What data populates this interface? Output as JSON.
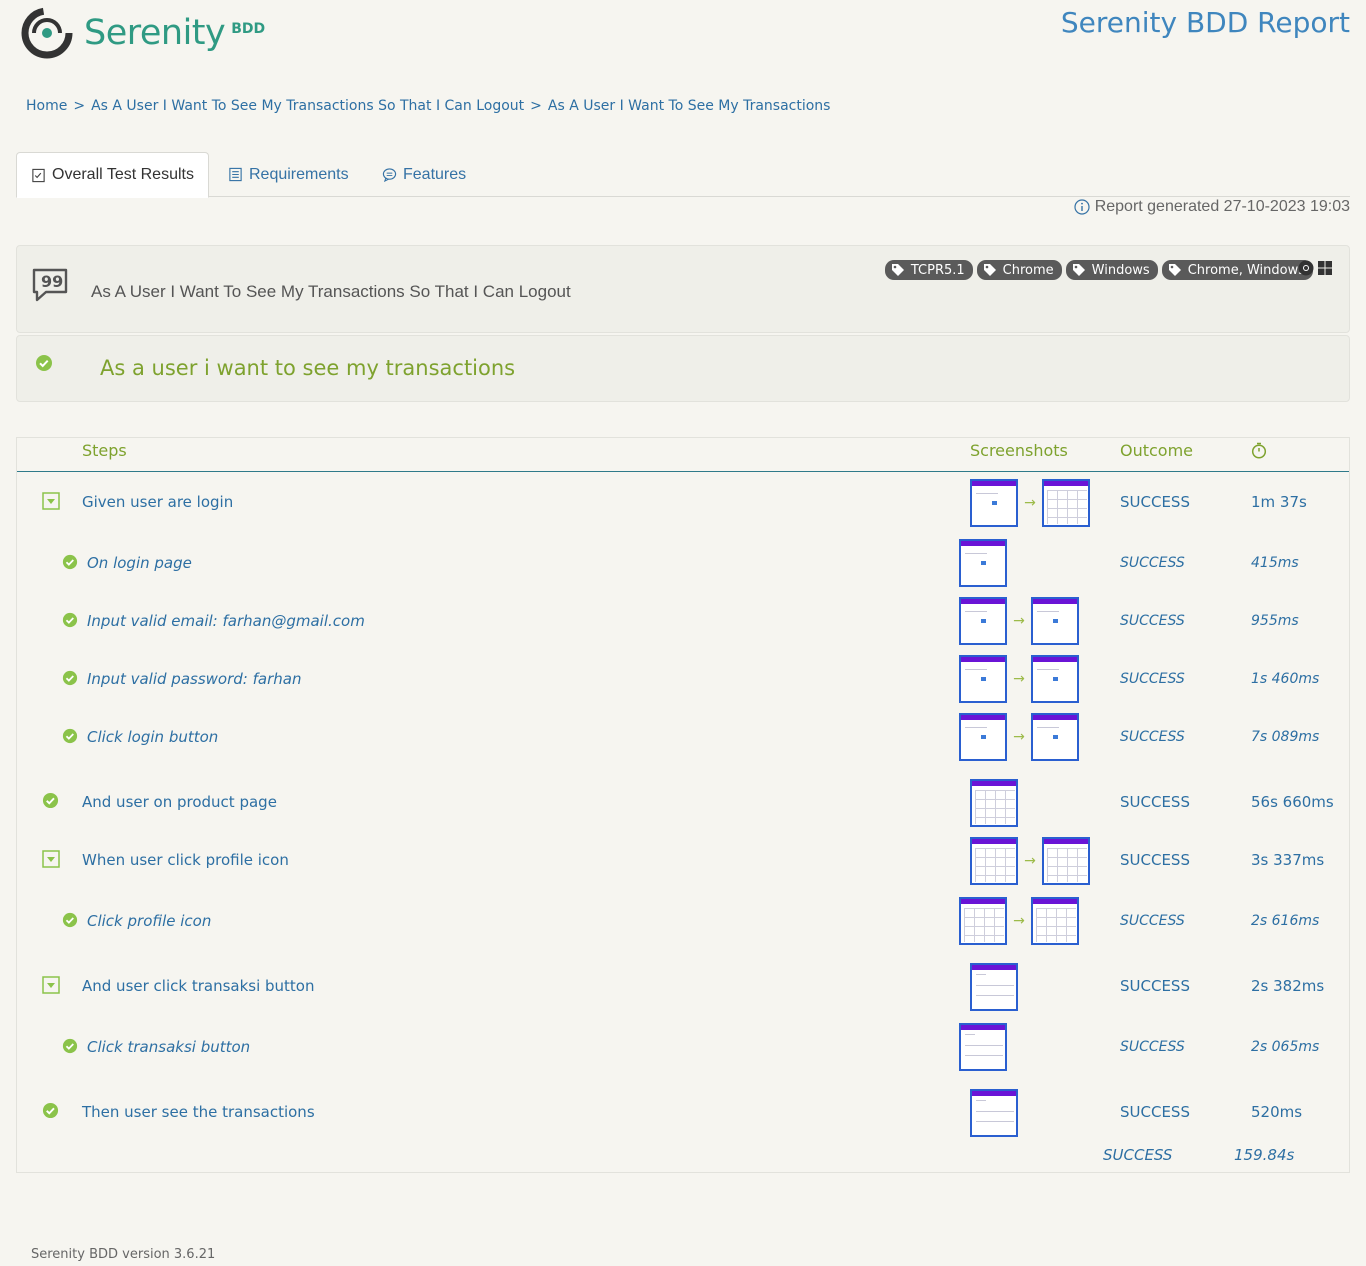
{
  "header": {
    "logo_text": "Serenity",
    "logo_suffix": "BDD",
    "report_title": "Serenity BDD Report"
  },
  "breadcrumb": [
    "Home",
    "As A User I Want To See My Transactions So That I Can Logout",
    "As A User I Want To See My Transactions"
  ],
  "tabs": [
    {
      "label": "Overall Test Results",
      "icon": "checklist-icon",
      "active": true
    },
    {
      "label": "Requirements",
      "icon": "list-icon",
      "active": false
    },
    {
      "label": "Features",
      "icon": "comment-icon",
      "active": false
    }
  ],
  "report_generated": "Report generated 27-10-2023 19:03",
  "feature": {
    "title": "As A User I Want To See My Transactions So That I Can Logout",
    "tags": [
      "TCPR5.1",
      "Chrome",
      "Windows",
      "Chrome, Windows"
    ]
  },
  "scenario": {
    "title": "As a user i want to see my transactions"
  },
  "steps_header": {
    "steps": "Steps",
    "screenshots": "Screenshots",
    "outcome": "Outcome"
  },
  "steps": [
    {
      "label": "Given user are login",
      "outcome": "SUCCESS",
      "duration": "1m 37s"
    },
    {
      "label": "On login page",
      "outcome": "SUCCESS",
      "duration": "415ms"
    },
    {
      "label": "Input valid email: farhan@gmail.com",
      "outcome": "SUCCESS",
      "duration": "955ms"
    },
    {
      "label": "Input valid password: farhan",
      "outcome": "SUCCESS",
      "duration": "1s 460ms"
    },
    {
      "label": "Click login button",
      "outcome": "SUCCESS",
      "duration": "7s 089ms"
    },
    {
      "label": "And user on product page",
      "outcome": "SUCCESS",
      "duration": "56s 660ms"
    },
    {
      "label": "When user click profile icon",
      "outcome": "SUCCESS",
      "duration": "3s 337ms"
    },
    {
      "label": "Click profile icon",
      "outcome": "SUCCESS",
      "duration": "2s 616ms"
    },
    {
      "label": "And user click transaksi button",
      "outcome": "SUCCESS",
      "duration": "2s 382ms"
    },
    {
      "label": "Click transaksi button",
      "outcome": "SUCCESS",
      "duration": "2s 065ms"
    },
    {
      "label": "Then user see the transactions",
      "outcome": "SUCCESS",
      "duration": "520ms"
    }
  ],
  "total": {
    "outcome": "SUCCESS",
    "duration": "159.84s"
  },
  "footer": "Serenity BDD version 3.6.21",
  "colors": {
    "success_green": "#8bc34a",
    "title_blue": "#3f86be",
    "step_green": "#7ea22e",
    "screenshot_bar": "#6a14d6"
  }
}
